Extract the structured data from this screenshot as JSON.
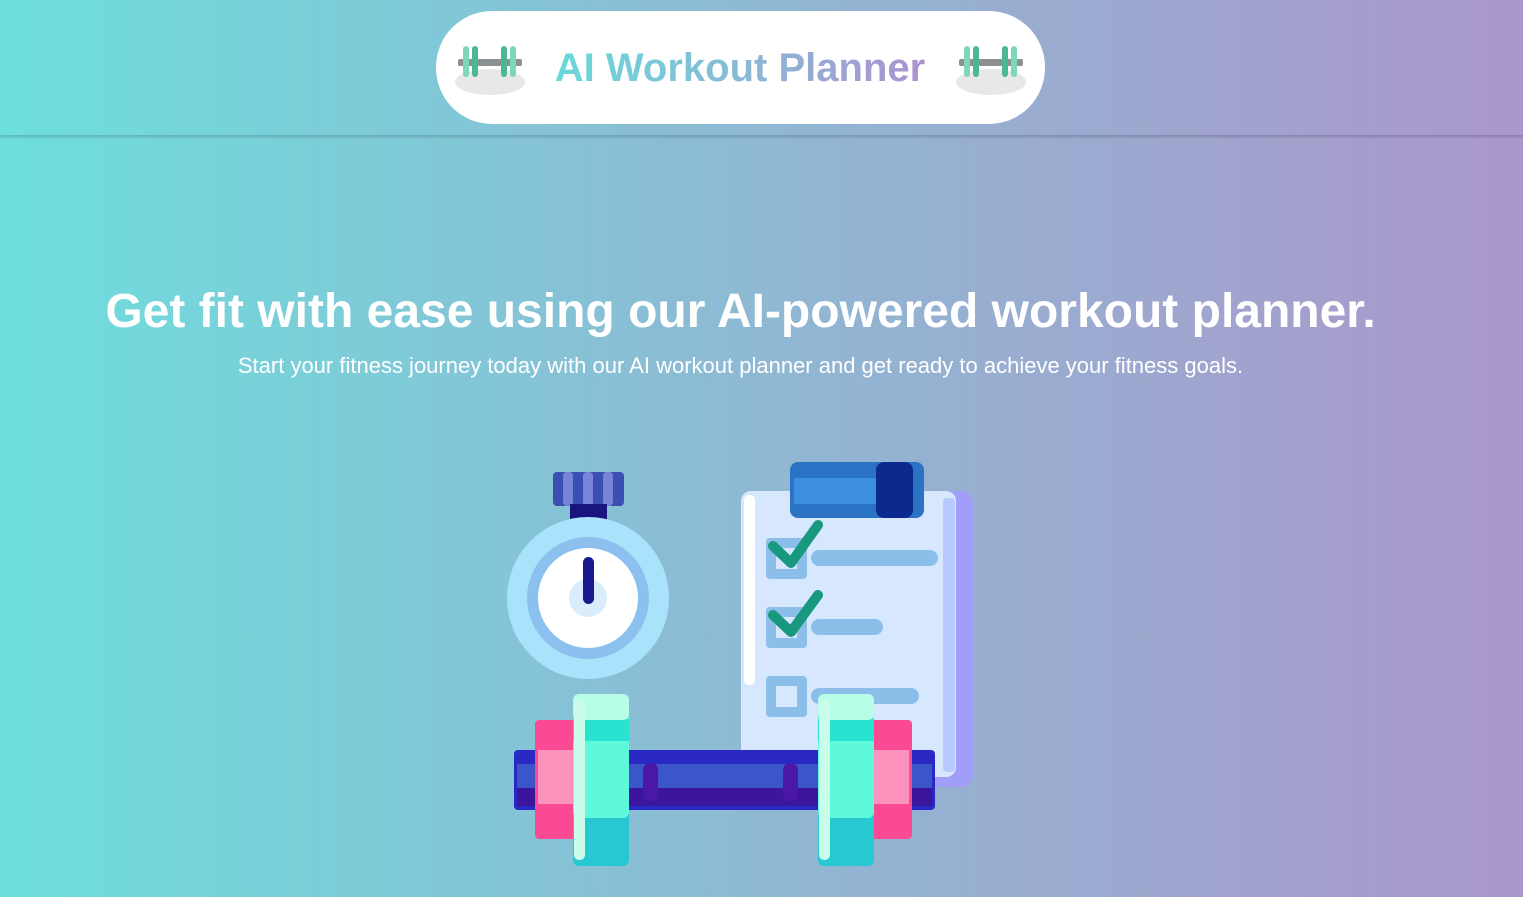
{
  "header": {
    "title": "AI Workout Planner",
    "left_icon": "dumbbell-icon",
    "right_icon": "dumbbell-icon"
  },
  "hero": {
    "headline": "Get fit with ease using our AI-powered workout planner.",
    "subheadline": "Start your fitness journey today with our AI workout planner and get ready to achieve your fitness goals.",
    "illustration": "stopwatch-checklist-dumbbell-illustration"
  },
  "colors": {
    "gradient_start": "#6ddedd",
    "gradient_end": "#ab97cb",
    "title_gradient_start": "#66dcd9",
    "title_gradient_end": "#b08ece"
  }
}
